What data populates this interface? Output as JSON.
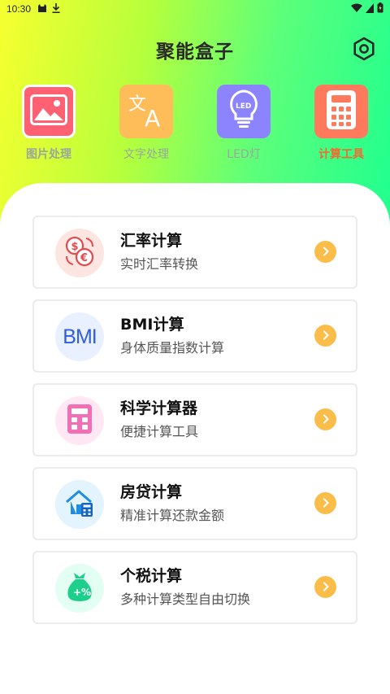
{
  "status": {
    "time": "10:30"
  },
  "app": {
    "title": "聚能盒子"
  },
  "tools": [
    {
      "label": "图片处理",
      "icon": "image-icon",
      "color": "#ff6173"
    },
    {
      "label": "文字处理",
      "icon": "translate-icon",
      "color": "#ffbd59"
    },
    {
      "label": "LED灯",
      "icon": "led-bulb-icon",
      "color": "#8c83ff"
    },
    {
      "label": "计算工具",
      "icon": "calculator-icon",
      "color": "#ff7a5c"
    }
  ],
  "cards": [
    {
      "title": "汇率计算",
      "subtitle": "实时汇率转换",
      "icon": "currency-exchange-icon",
      "bg": "#fde6e2"
    },
    {
      "title": "BMI计算",
      "subtitle": "身体质量指数计算",
      "icon": "bmi-icon",
      "icon_text": "BMI",
      "bg": "#e9f0ff"
    },
    {
      "title": "科学计算器",
      "subtitle": "便捷计算工具",
      "icon": "scientific-calculator-icon",
      "bg": "#ffe8f3"
    },
    {
      "title": "房贷计算",
      "subtitle": "精准计算还款金额",
      "icon": "house-loan-icon",
      "bg": "#e3f4ff"
    },
    {
      "title": "个税计算",
      "subtitle": "多种计算类型自由切换",
      "icon": "tax-bag-icon",
      "bg": "#e3fff3"
    }
  ],
  "colors": {
    "accent_orange": "#fbbd4a",
    "active_tab": "#f06b2f"
  }
}
